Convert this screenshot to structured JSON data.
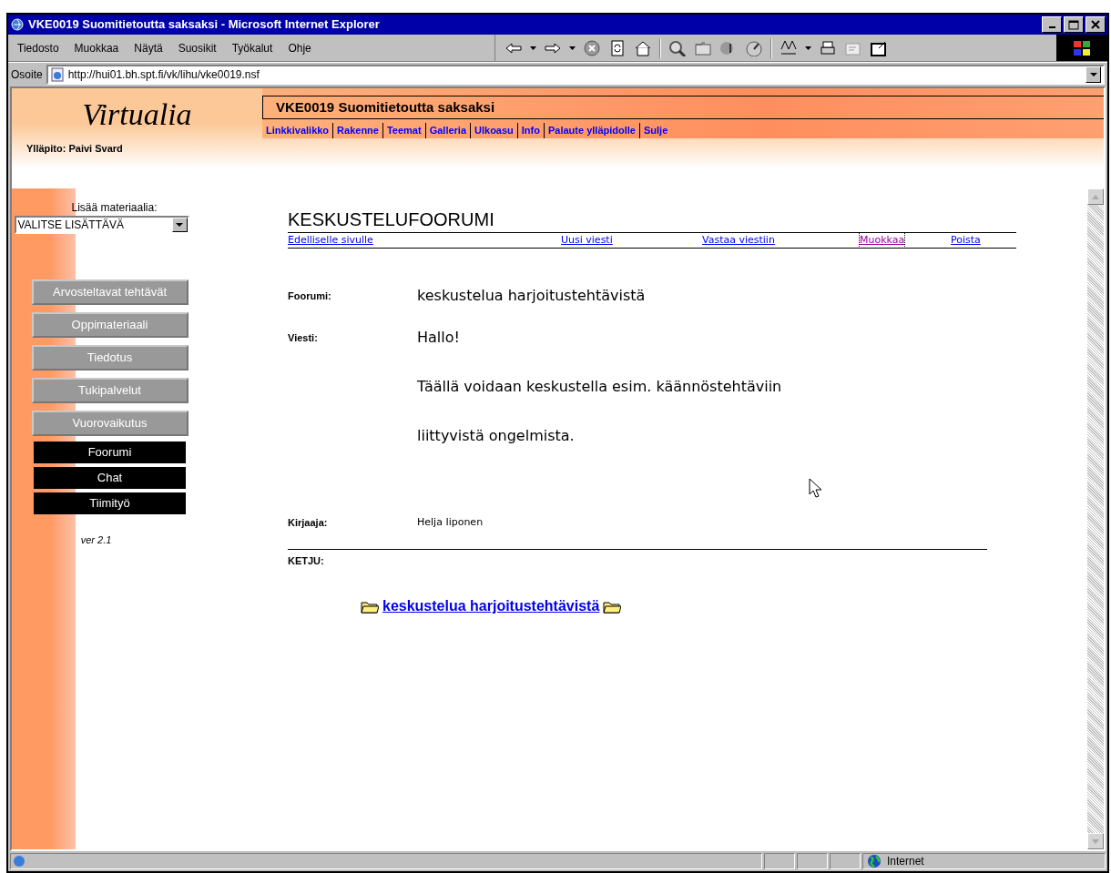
{
  "window": {
    "title": "VKE0019 Suomitietoutta saksaksi - Microsoft Internet Explorer"
  },
  "menu": [
    {
      "label": "Tiedosto"
    },
    {
      "label": "Muokkaa"
    },
    {
      "label": "Näytä"
    },
    {
      "label": "Suosikit"
    },
    {
      "label": "Työkalut"
    },
    {
      "label": "Ohje"
    }
  ],
  "address_bar": {
    "label": "Osoite",
    "url": "http://hui01.bh.spt.fi/vk/lihu/vke0019.nsf"
  },
  "header": {
    "logo": "Virtualia",
    "maintainer": "Ylläpito: Paivi Svard",
    "course_title": "VKE0019 Suomitietoutta saksaksi",
    "nav": [
      "Linkkivalikko",
      "Rakenne",
      "Teemat",
      "Galleria",
      "Ulkoasu",
      "Info",
      "Palaute ylläpidolle",
      "Sulje"
    ]
  },
  "sidebar": {
    "add_label": "Lisää materiaalia:",
    "add_select": "VALITSE LISÄTTÄVÄ",
    "items": [
      {
        "label": "Arvosteltavat tehtävät",
        "kind": "main"
      },
      {
        "label": "Oppimateriaali",
        "kind": "main"
      },
      {
        "label": "Tiedotus",
        "kind": "main"
      },
      {
        "label": "Tukipalvelut",
        "kind": "main"
      },
      {
        "label": "Vuorovaikutus",
        "kind": "main"
      },
      {
        "label": "Foorumi",
        "kind": "sub"
      },
      {
        "label": "Chat",
        "kind": "sub"
      },
      {
        "label": "Tiimityö",
        "kind": "sub"
      }
    ],
    "version": "ver 2.1"
  },
  "content": {
    "heading": "KESKUSTELUFOORUMI",
    "actions": [
      {
        "label": "Edelliselle sivulle",
        "visited": false,
        "focused": false
      },
      {
        "label": "Uusi viesti",
        "visited": false,
        "focused": false
      },
      {
        "label": "Vastaa viestiin",
        "visited": false,
        "focused": false
      },
      {
        "label": "Muokkaa",
        "visited": true,
        "focused": true
      },
      {
        "label": "Poista",
        "visited": false,
        "focused": false
      }
    ],
    "forum_label": "Foorumi:",
    "forum": "keskustelua harjoitustehtävistä",
    "message_label": "Viesti:",
    "message_lines": [
      "Hallo!",
      "Täällä voidaan keskustella esim. käännöstehtäviin",
      "liittyvistä ongelmista."
    ],
    "author_label": "Kirjaaja:",
    "author": "Helja Iiponen",
    "thread_label": "KETJU:",
    "thread_link": "keskustelua harjoitustehtävistä"
  },
  "status_bar": {
    "zone": "Internet"
  }
}
